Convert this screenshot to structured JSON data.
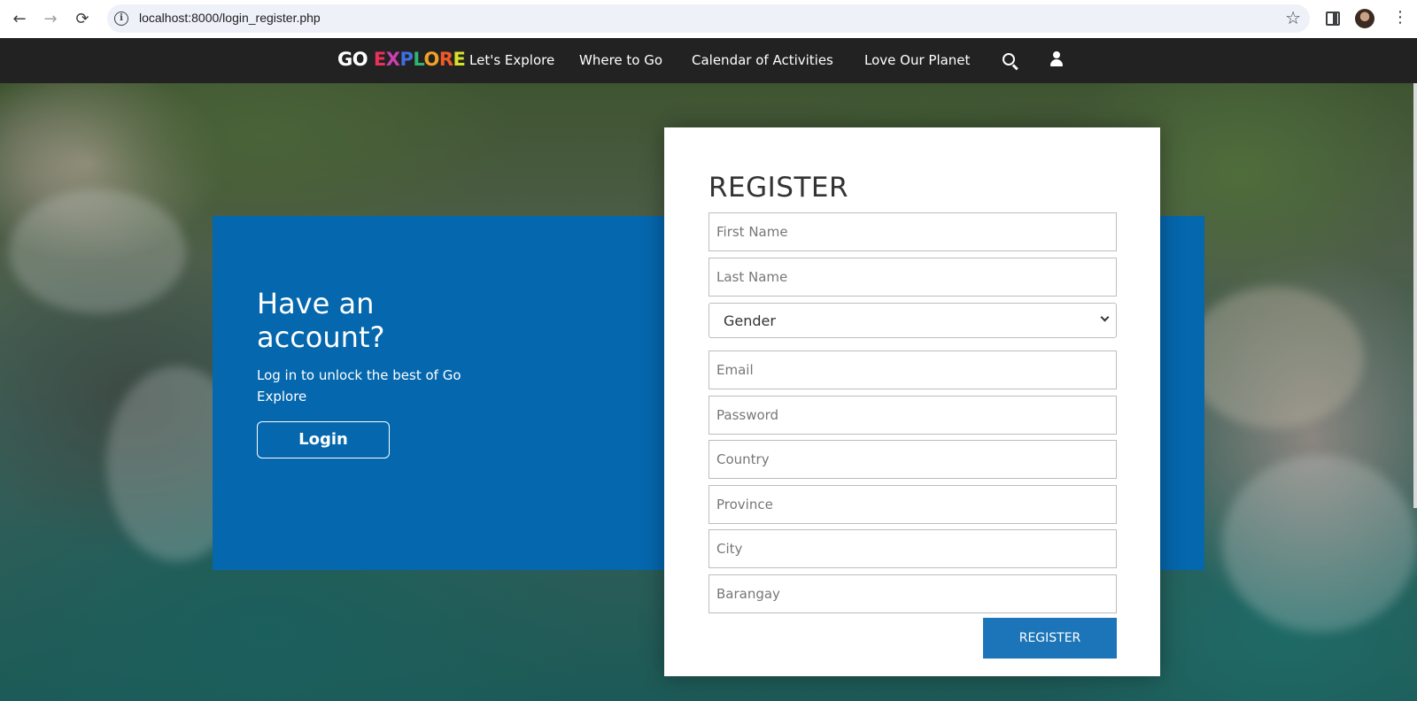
{
  "browser": {
    "url": "localhost:8000/login_register.php",
    "back_icon": "←",
    "forward_icon": "→",
    "reload_icon": "⟳",
    "info_icon": "i",
    "star_icon": "☆",
    "menu_icon": "⋮"
  },
  "header": {
    "logo_go": "GO ",
    "logo_letters": [
      {
        "char": "E",
        "color": "#e8315b"
      },
      {
        "char": "X",
        "color": "#cc3fb0"
      },
      {
        "char": "P",
        "color": "#3f6fe0"
      },
      {
        "char": "L",
        "color": "#2bb673"
      },
      {
        "char": "O",
        "color": "#f1a126"
      },
      {
        "char": "R",
        "color": "#f05a28"
      },
      {
        "char": "E",
        "color": "#d7e02b"
      }
    ],
    "menu": [
      "Let's Explore",
      "Where to Go",
      "Calendar of Activities",
      "Love Our Planet"
    ]
  },
  "login_panel": {
    "heading": "Have an account?",
    "subtitle": "Log in to unlock the best of Go Explore",
    "button": "Login",
    "color": "#0567ad"
  },
  "register": {
    "title": "REGISTER",
    "fields": {
      "first_name": "First Name",
      "last_name": "Last Name",
      "email": "Email",
      "password": "Password",
      "country": "Country",
      "province": "Province",
      "city": "City",
      "barangay": "Barangay"
    },
    "gender_selected": "Gender",
    "button": "REGISTER",
    "button_color": "#1b75b8"
  }
}
